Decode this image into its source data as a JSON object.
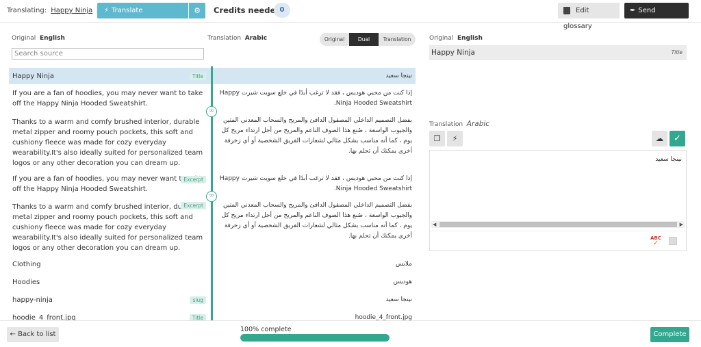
{
  "header": {
    "translating_label": "Translating:",
    "product_name": "Happy Ninja",
    "translate_button": "Translate automatically",
    "credits_label": "Credits needed",
    "credits_value": "0",
    "glossary_button": "Edit glossary",
    "feedback_button": "Send feedback"
  },
  "left_panel": {
    "original_label": "Original",
    "original_lang": "English",
    "translation_label": "Translation",
    "translation_lang": "Arabic",
    "view_modes": [
      "Original",
      "Dual",
      "Translation"
    ],
    "active_view": "Dual",
    "search_placeholder": "Search source"
  },
  "rows": [
    {
      "source": "Happy Ninja",
      "tag": "Title",
      "target": "نينجا سعيد"
    },
    {
      "source": "If you are a fan of hoodies, you may never want to take off the Happy Ninja Hooded Sweatshirt.",
      "tag": "",
      "target": "إذا كنت من محبي هوديس ، فقد لا ترغب أبدًا في خلع سويت شيرت Happy Ninja Hooded Sweatshirt."
    },
    {
      "source": "Thanks to a warm and comfy brushed interior, durable metal zipper and roomy pouch pockets, this soft and cushiony fleece was made for cozy everyday wearability.It's also ideally suited for personalized team logos or any other decoration you can dream up.",
      "tag": "",
      "target": "بفضل التصميم الداخلي المصقول الدافئ والمريح والسحاب المعدني المتين والجيوب الواسعة ، صُنع هذا الصوف الناعم والمريح من أجل ارتداء مريح كل يوم ، كما أنه مناسب بشكل مثالي لشعارات الفريق الشخصية أو أي زخرفة أخرى يمكنك أن تحلم بها."
    },
    {
      "source": "If you are a fan of hoodies, you may never want to take off the Happy Ninja Hooded Sweatshirt.",
      "tag": "Excerpt",
      "target": "إذا كنت من محبي هوديس ، فقد لا ترغب أبدًا في خلع سويت شيرت Happy Ninja Hooded Sweatshirt."
    },
    {
      "source": "Thanks to a warm and comfy brushed interior, durable metal zipper and roomy pouch pockets, this soft and cushiony fleece was made for cozy everyday wearability.It's also ideally suited for personalized team logos or any other decoration you can dream up.",
      "tag": "Excerpt",
      "target": "بفضل التصميم الداخلي المصقول الدافئ والمريح والسحاب المعدني المتين والجيوب الواسعة ، صُنع هذا الصوف الناعم والمريح من أجل ارتداء مريح كل يوم ، كما أنه مناسب بشكل مثالي لشعارات الفريق الشخصية أو أي زخرفة أخرى يمكنك أن تحلم بها."
    },
    {
      "source": "Clothing",
      "tag": "",
      "target": "ملابس"
    },
    {
      "source": "Hoodies",
      "tag": "",
      "target": "هوديس"
    },
    {
      "source": "happy-ninja",
      "tag": "slug",
      "target": "نينجا سعيد"
    },
    {
      "source": "hoodie_4_front.jpg",
      "tag": "Title",
      "target": "hoodie_4_front.jpg"
    }
  ],
  "right_panel": {
    "original_label": "Original",
    "original_lang": "English",
    "original_text": "Happy Ninja",
    "original_tag": "Title",
    "translation_label": "Translation",
    "translation_lang": "Arabic",
    "translation_text": "نينجا سعيد",
    "spell_label": "ABC"
  },
  "footer": {
    "back_button": "← Back to list",
    "progress_label": "100% complete",
    "progress_value": 100,
    "complete_button": "Complete"
  },
  "colors": {
    "accent": "#32a88f",
    "translate_blue": "#5eb8d0",
    "active_row": "#d5e6f3"
  }
}
